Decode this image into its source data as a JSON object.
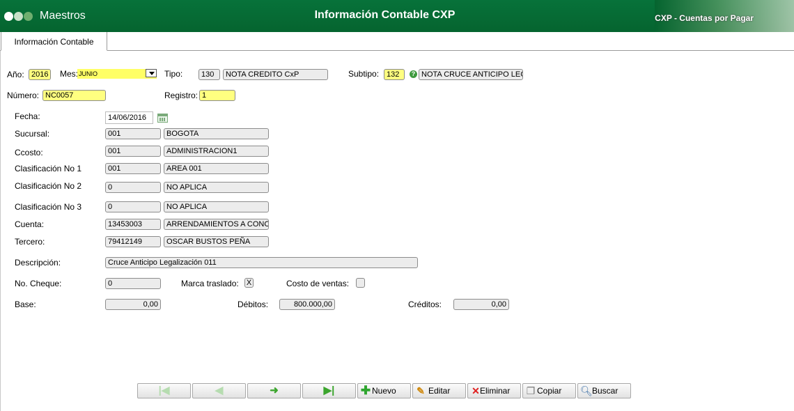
{
  "header": {
    "app_title": "Maestros",
    "page_title": "Información Contable CXP",
    "module_title": "CXP - Cuentas por Pagar",
    "colors": {
      "bar": "#07723a",
      "dot_light": "#ffffff",
      "dot_mid": "#c8e0c8",
      "dot_dark": "#6fae6f"
    }
  },
  "tabs": {
    "active": "Información Contable"
  },
  "form": {
    "anio": {
      "label": "Año:",
      "value": "2016"
    },
    "mes": {
      "label": "Mes:",
      "value": "JUNIO"
    },
    "tipo": {
      "label": "Tipo:",
      "code": "130",
      "desc": "NOTA CREDITO CxP"
    },
    "subtipo": {
      "label": "Subtipo:",
      "code": "132",
      "desc": "NOTA CRUCE ANTICIPO LEG"
    },
    "numero": {
      "label": "Número:",
      "value": "NC0057"
    },
    "registro": {
      "label": "Registro:",
      "value": "1"
    },
    "fecha": {
      "label": "Fecha:",
      "value": "14/06/2016"
    },
    "sucursal": {
      "label": "Sucursal:",
      "code": "001",
      "desc": "BOGOTA"
    },
    "ccosto": {
      "label": "Ccosto:",
      "code": "001",
      "desc": "ADMINISTRACION1"
    },
    "clasif1": {
      "label": "Clasificación No 1",
      "code": "001",
      "desc": "AREA 001"
    },
    "clasif2": {
      "label": "Clasificación No 2",
      "code": "0",
      "desc": "NO APLICA"
    },
    "clasif3": {
      "label": "Clasificación No 3",
      "code": "0",
      "desc": "NO APLICA"
    },
    "cuenta": {
      "label": "Cuenta:",
      "code": "13453003",
      "desc": "ARRENDAMIENTOS A CONCE"
    },
    "tercero": {
      "label": "Tercero:",
      "code": "79412149",
      "desc": "OSCAR BUSTOS PEÑA"
    },
    "descripcion": {
      "label": "Descripción:",
      "value": "Cruce Anticipo Legalización 011"
    },
    "cheque": {
      "label": "No. Cheque:",
      "value": "0"
    },
    "marca_traslado": {
      "label": "Marca traslado:",
      "value": "X"
    },
    "costo_ventas": {
      "label": "Costo de ventas:",
      "value": ""
    },
    "base": {
      "label": "Base:",
      "value": "0,00"
    },
    "debitos": {
      "label": "Débitos:",
      "value": "800.000,00"
    },
    "creditos": {
      "label": "Créditos:",
      "value": "0,00"
    }
  },
  "toolbar": {
    "first_icon": "first-record-icon",
    "prev_icon": "arrow-left-icon",
    "next_icon": "arrow-right-icon",
    "last_icon": "last-record-icon",
    "nuevo": "Nuevo",
    "editar": "Editar",
    "eliminar": "Eliminar",
    "copiar": "Copiar",
    "buscar": "Buscar"
  }
}
